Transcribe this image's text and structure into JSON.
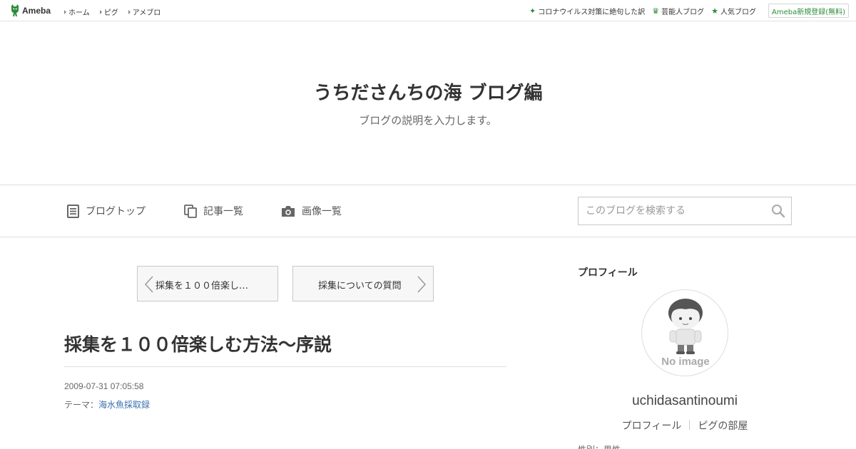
{
  "topbar": {
    "logo_text": "Ameba",
    "nav": [
      "ホーム",
      "ピグ",
      "アメブロ"
    ],
    "right_links": [
      {
        "icon": "sparkle-icon",
        "label": "コロナウイルス対策に絶句した訳"
      },
      {
        "icon": "crown-icon",
        "label": "芸能人ブログ"
      },
      {
        "icon": "star-icon",
        "label": "人気ブログ"
      }
    ],
    "register_label": "Ameba新規登録(無料)"
  },
  "header": {
    "title": "うちださんちの海 ブログ編",
    "description": "ブログの説明を入力します。"
  },
  "navbar": {
    "items": [
      {
        "icon": "document-icon",
        "label": "ブログトップ"
      },
      {
        "icon": "copy-icon",
        "label": "記事一覧"
      },
      {
        "icon": "camera-icon",
        "label": "画像一覧"
      }
    ],
    "search_placeholder": "このブログを検索する"
  },
  "pager": {
    "prev_label": "採集を１００倍楽し…",
    "next_label": "採集についての質問"
  },
  "article": {
    "title": "採集を１００倍楽しむ方法～序説",
    "date": "2009-07-31 07:05:58",
    "theme_prefix": "テーマ：",
    "theme_link": "海水魚採取録"
  },
  "sidebar": {
    "heading": "プロフィール",
    "avatar_caption": "No image",
    "username": "uchidasantinoumi",
    "links": [
      "プロフィール",
      "ピグの部屋"
    ],
    "cutoff_text": "性別：男性"
  },
  "colors": {
    "brand_green": "#2d8c3c",
    "link_blue": "#3a6fb0"
  }
}
